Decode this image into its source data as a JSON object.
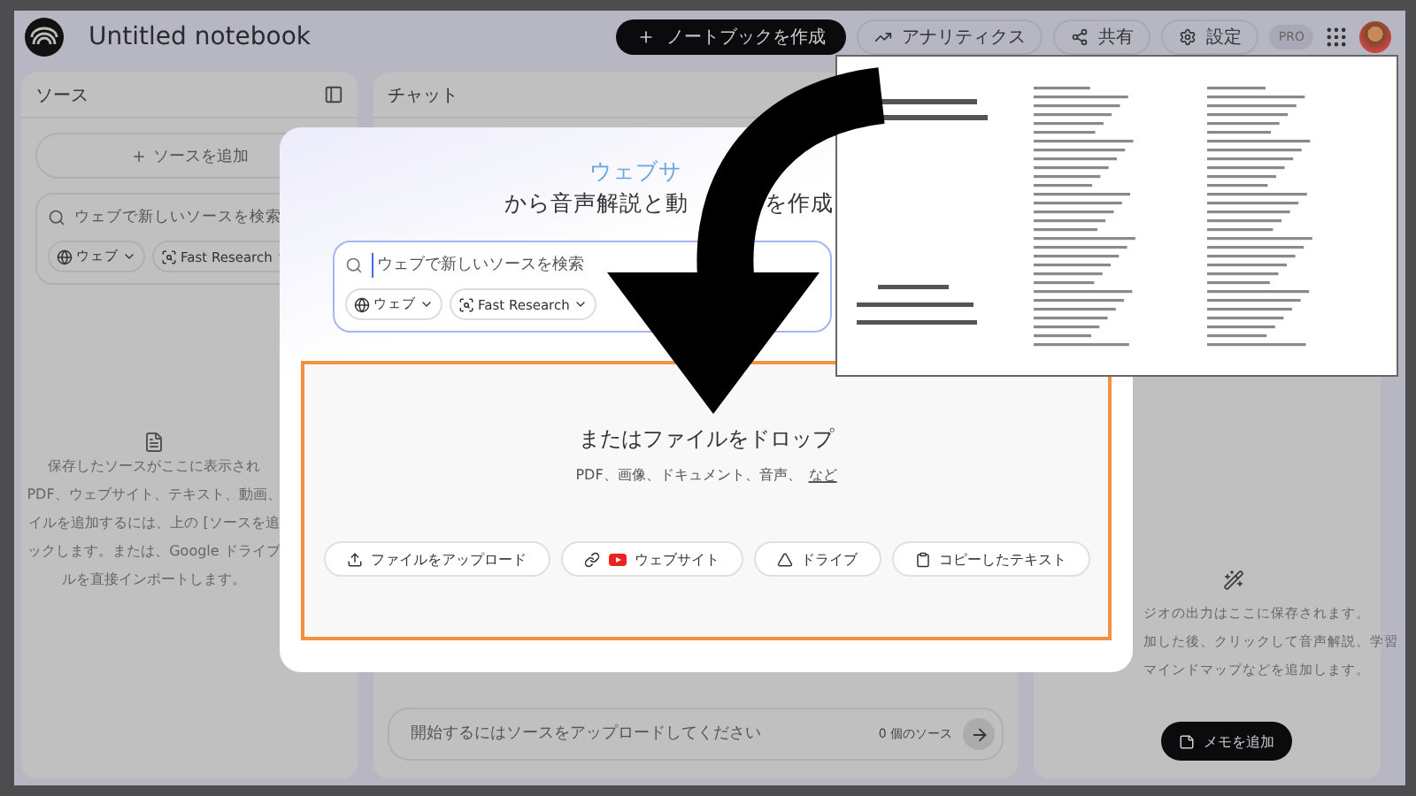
{
  "topbar": {
    "title": "Untitled notebook",
    "create_button": "ノートブックを作成",
    "analytics_button": "アナリティクス",
    "share_button": "共有",
    "settings_button": "設定",
    "plan_badge": "PRO"
  },
  "sources_panel": {
    "title": "ソース",
    "add_button": "ソースを追加",
    "search": {
      "placeholder": "ウェブで新しいソースを検索"
    },
    "chips": [
      "ウェブ",
      "Fast Research"
    ],
    "empty_lines": [
      "保存したソースがここに表示され",
      "PDF、ウェブサイト、テキスト、動画、",
      "イルを追加するには、上の [ソースを追",
      "ックします。または、Google ドライブ",
      "ルを直接インポートします。"
    ]
  },
  "chat_panel": {
    "title": "チャット",
    "input": {
      "placeholder": "開始するにはソースをアップロードしてください"
    },
    "source_count": "0 個のソース"
  },
  "studio_panel": {
    "lines": [
      "ジオの出力はここに保存されます。",
      "加した後、クリックして音声解説、学習",
      "マインドマップなどを追加します。"
    ],
    "add_note_button": "メモを追加"
  },
  "modal": {
    "heading_line1": "ウェブサ",
    "heading_line2": [
      "から音声解説と動",
      "を作成"
    ],
    "search": {
      "placeholder": "ウェブで新しいソースを検索"
    },
    "chips": [
      "ウェブ",
      "Fast Research"
    ],
    "drop_title": "またはファイルをドロップ",
    "drop_hint": "PDF、画像、ドキュメント、音声、",
    "more_link": "など",
    "actions": [
      {
        "kind": "upload",
        "label": "ファイルをアップロード"
      },
      {
        "kind": "website",
        "label": "ウェブサイト"
      },
      {
        "kind": "drive",
        "label": "ドライブ"
      },
      {
        "kind": "paste",
        "label": "コピーしたテキスト"
      }
    ]
  }
}
